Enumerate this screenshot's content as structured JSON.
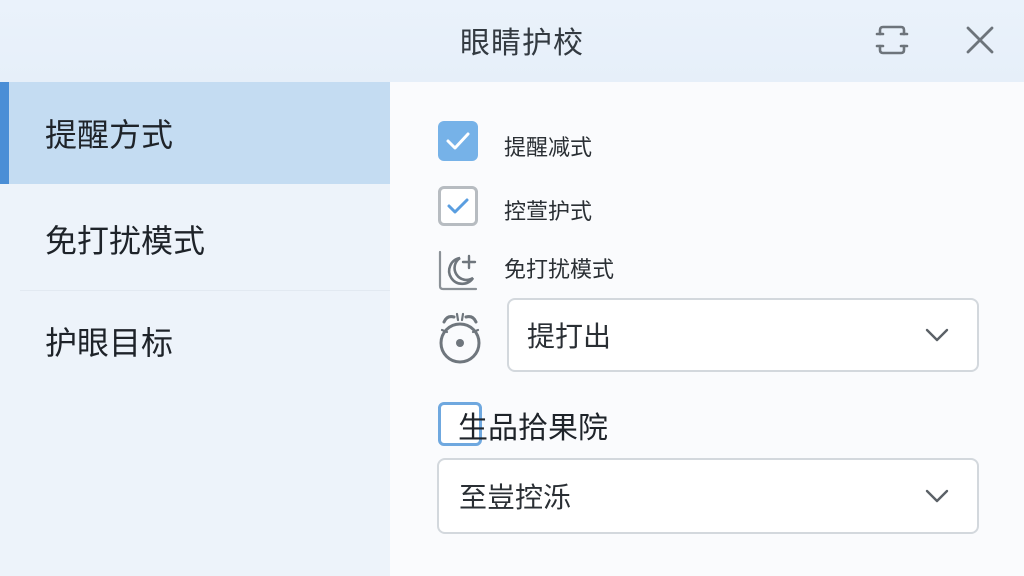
{
  "window": {
    "title": "眼睛护校",
    "restore_icon": "restore-icon",
    "close_icon": "close-icon"
  },
  "sidebar": {
    "items": [
      {
        "label": "提醒方式",
        "selected": true
      },
      {
        "label": "免打扰模式",
        "selected": false
      },
      {
        "label": "护眼目标",
        "selected": false
      }
    ],
    "accent_color": "#4a8ed6",
    "selected_bg": "#c4dcf2"
  },
  "main": {
    "options": [
      {
        "label": "提醒减式",
        "checked": true,
        "style": "filled"
      },
      {
        "label": "控萱护式",
        "checked": true,
        "style": "outline"
      },
      {
        "label": "免打扰模式",
        "icon": "moon-plus-icon"
      }
    ],
    "alarm_icon": "alarm-clock-icon",
    "dropdown1": {
      "value": "提打出"
    },
    "section": {
      "label": "生品拾果院",
      "checked": false
    },
    "dropdown2": {
      "value": "至豈控泺"
    }
  }
}
